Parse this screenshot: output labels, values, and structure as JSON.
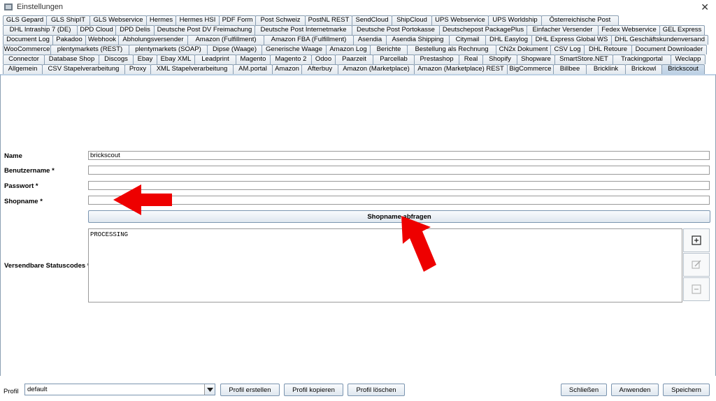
{
  "window": {
    "title": "Einstellungen"
  },
  "tabs": {
    "row1": [
      "GLS Gepard",
      "GLS ShipIT",
      "GLS Webservice",
      "Hermes",
      "Hermes HSI",
      "PDF Form",
      "Post Schweiz",
      "PostNL REST",
      "SendCloud",
      "ShipCloud",
      "UPS Webservice",
      "UPS Worldship",
      "Österreichische Post"
    ],
    "row2": [
      "DHL Intraship 7 (DE)",
      "DPD Cloud",
      "DPD Delis",
      "Deutsche Post DV Freimachung",
      "Deutsche Post Internetmarke",
      "Deutsche Post Portokasse",
      "Deutschepost PackagePlus",
      "Einfacher Versender",
      "Fedex Webservice",
      "GEL Express"
    ],
    "row3": [
      "Document Log",
      "Pakadoo",
      "Webhook",
      "Abholungsversender",
      "Amazon (Fulfillment)",
      "Amazon FBA (Fulfillment)",
      "Asendia",
      "Asendia Shipping",
      "Citymail",
      "DHL Easylog",
      "DHL Express Global WS",
      "DHL Geschäftskundenversand"
    ],
    "row4": [
      "WooCommerce",
      "plentymarkets (REST)",
      "plentymarkets (SOAP)",
      "Dipse (Waage)",
      "Generische Waage",
      "Amazon Log",
      "Berichte",
      "Bestellung als Rechnung",
      "CN2x Dokument",
      "CSV Log",
      "DHL Retoure",
      "Document Downloader"
    ],
    "row5": [
      "Connector",
      "Database Shop",
      "Discogs",
      "Ebay",
      "Ebay XML",
      "Leadprint",
      "Magento",
      "Magento 2",
      "Odoo",
      "Paarzeit",
      "Parcellab",
      "Prestashop",
      "Real",
      "Shopify",
      "Shopware",
      "SmartStore.NET",
      "Trackingportal",
      "Weclapp"
    ],
    "row6": [
      "Allgemein",
      "CSV Stapelverarbeitung",
      "Proxy",
      "XML Stapelverarbeitung",
      "AM.portal",
      "Amazon",
      "Afterbuy",
      "Amazon (Marketplace)",
      "Amazon (Marketplace) REST",
      "BigCommerce",
      "Billbee",
      "Bricklink",
      "Brickowl",
      "Brickscout"
    ],
    "selected": "Brickscout"
  },
  "form": {
    "name_label": "Name",
    "name_value": "brickscout",
    "user_label": "Benutzername *",
    "user_value": "",
    "password_label": "Passwort *",
    "password_value": "",
    "shopname_label": "Shopname *",
    "shopname_value": "",
    "shopname_button": "Shopname abfragen",
    "status_label": "Versendbare Statuscodes *",
    "status_value": "PROCESSING"
  },
  "bottom": {
    "profile_label": "Profil",
    "profile_value": "default",
    "create_button": "Profil erstellen",
    "copy_button": "Profil kopieren",
    "delete_button": "Profil löschen",
    "close_button": "Schließen",
    "apply_button": "Anwenden",
    "save_button": "Speichern"
  },
  "colors": {
    "arrow": "#ee0000",
    "tab_selected": "#bcd0e4"
  },
  "icons": {
    "add": "plus-icon",
    "edit": "edit-icon",
    "remove": "minus-icon",
    "close": "close-icon"
  }
}
